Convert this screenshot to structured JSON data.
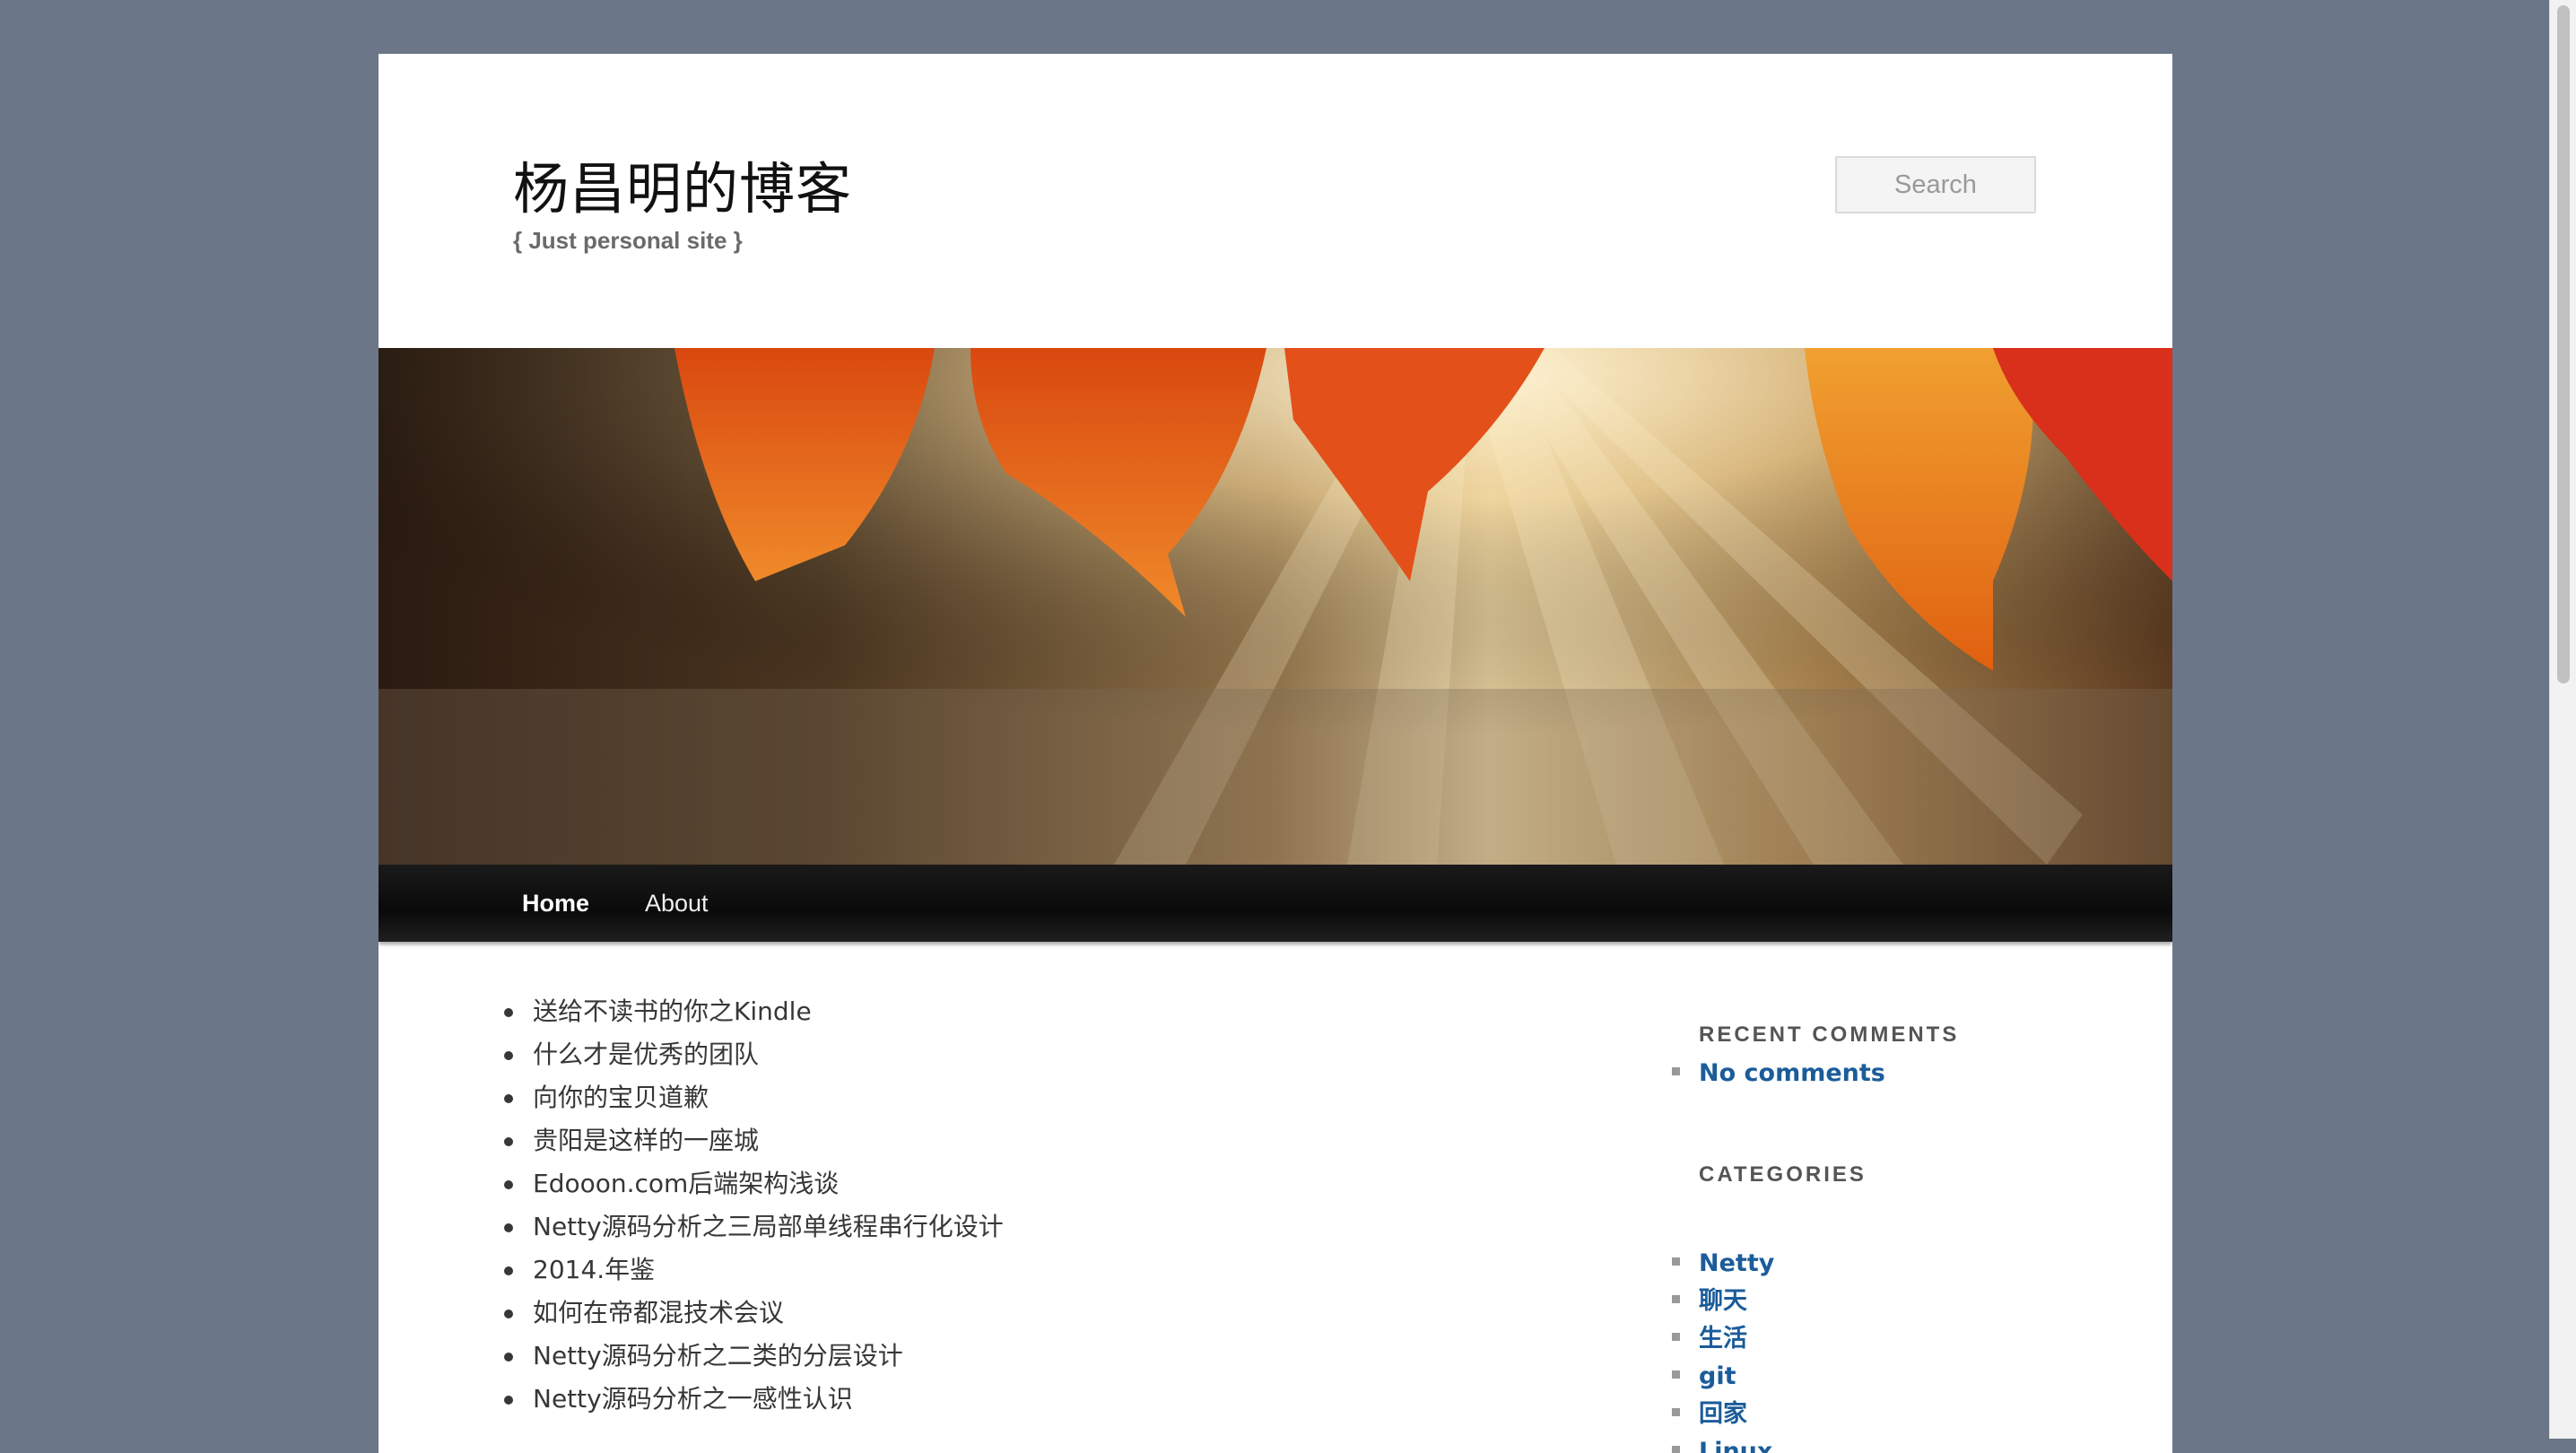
{
  "site": {
    "title": "杨昌明的博客",
    "description": "{ Just personal site }"
  },
  "search": {
    "placeholder": "Search"
  },
  "nav": {
    "items": [
      {
        "label": "Home",
        "active": true
      },
      {
        "label": "About",
        "active": false
      }
    ]
  },
  "posts": [
    "送给不读书的你之Kindle",
    "什么才是优秀的团队",
    "向你的宝贝道歉",
    "贵阳是这样的一座城",
    "Edooon.com后端架构浅谈",
    "Netty源码分析之三局部单线程串行化设计",
    "2014.年鉴",
    "如何在帝都混技术会议",
    "Netty源码分析之二类的分层设计",
    "Netty源码分析之一感性认识"
  ],
  "sidebar": {
    "recent_comments": {
      "title": "RECENT COMMENTS",
      "items": [
        "No comments"
      ]
    },
    "categories": {
      "title": "CATEGORIES",
      "items": [
        "Netty",
        "聊天",
        "生活",
        "git",
        "回家",
        "Linux"
      ]
    }
  },
  "colors": {
    "background": "#6b7788",
    "link": "#1b5c9a",
    "nav_bar": "#111111"
  }
}
